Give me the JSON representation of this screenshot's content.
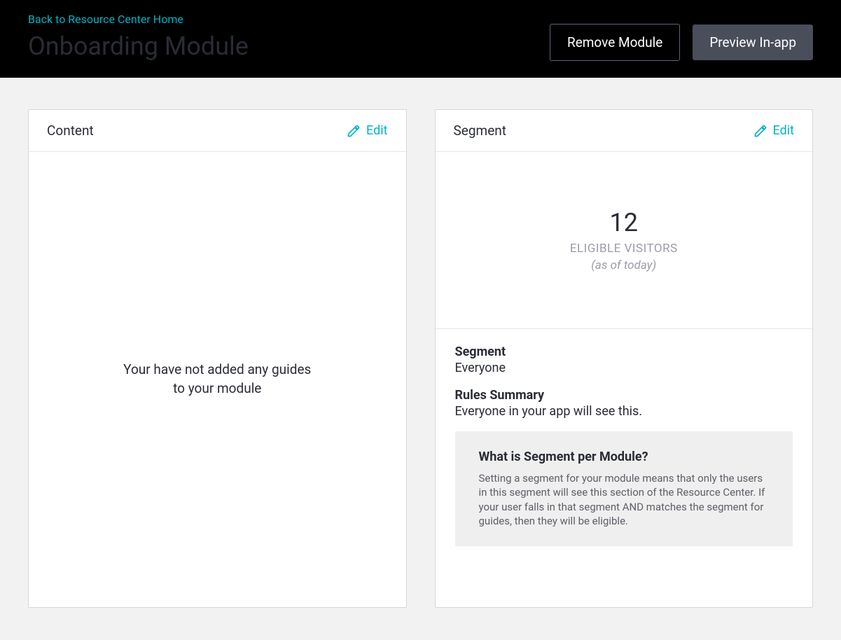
{
  "header": {
    "back_link": "Back to Resource Center Home",
    "title": "Onboarding Module",
    "remove_button": "Remove Module",
    "preview_button": "Preview In-app"
  },
  "content_card": {
    "title": "Content",
    "edit": "Edit",
    "empty_line1": "Your have not added any guides",
    "empty_line2": "to your module"
  },
  "segment_card": {
    "title": "Segment",
    "edit": "Edit",
    "stat_number": "12",
    "stat_label": "ELIGIBLE VISITORS",
    "stat_sub": "(as of today)",
    "segment_label": "Segment",
    "segment_value": "Everyone",
    "rules_label": "Rules Summary",
    "rules_value": "Everyone in your app will see this.",
    "info_title": "What is Segment per Module?",
    "info_text": "Setting a segment for your module means that only the users in this segment will see this section of the Resource Center. If your user falls in that segment AND matches the segment for guides, then they will be eligible."
  }
}
